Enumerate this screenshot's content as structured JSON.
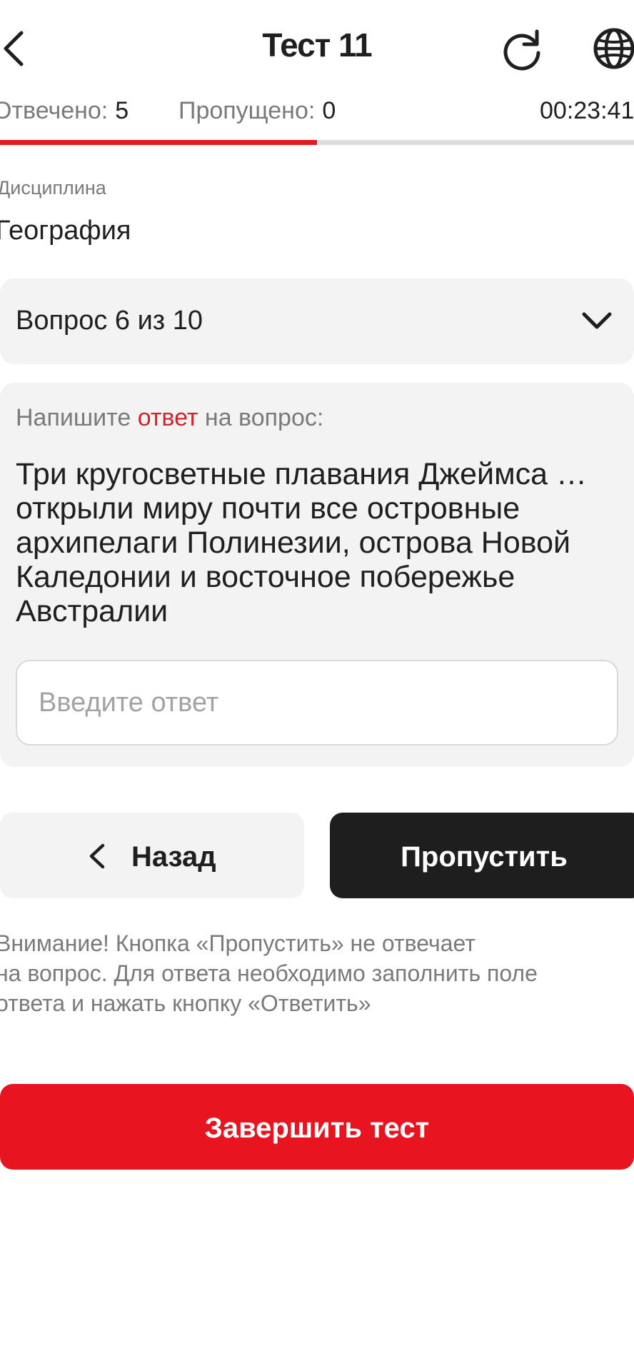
{
  "header": {
    "title": "Тест 11",
    "back_icon": "chevron-left-icon",
    "refresh_icon": "refresh-icon",
    "language_icon": "globe-icon"
  },
  "stats": {
    "answered_label": "Отвечено:",
    "answered_value": "5",
    "skipped_label": "Пропущено:",
    "skipped_value": "0",
    "timer": "00:23:41"
  },
  "progress": {
    "fraction": 0.5
  },
  "discipline": {
    "label": "Дисциплина",
    "value": "География"
  },
  "question_selector": {
    "label": "Вопрос 6 из 10",
    "icon": "chevron-down-icon"
  },
  "question": {
    "prompt_before": "Напишите ",
    "prompt_highlight": "ответ",
    "prompt_after": " на вопрос:",
    "text": "Три кругосветные плавания Джеймса … открыли миру почти все островные архипелаги Полинезии, острова Новой Каледонии и восточное побережье Австралии",
    "answer_placeholder": "Введите ответ",
    "answer_value": ""
  },
  "buttons": {
    "back_label": "Назад",
    "skip_label": "Пропустить",
    "finish_label": "Завершить тест"
  },
  "warning": {
    "line1": "Внимание! Кнопка «Пропустить» не отвечает",
    "line2": "на вопрос. Для ответа необходимо заполнить поле",
    "line3": "ответа и нажать кнопку «Ответить»"
  },
  "colors": {
    "accent_red": "#e8141f",
    "dark_button": "#1e1e1e",
    "card_bg": "#f3f3f3",
    "muted_text": "#7a7a7a"
  }
}
